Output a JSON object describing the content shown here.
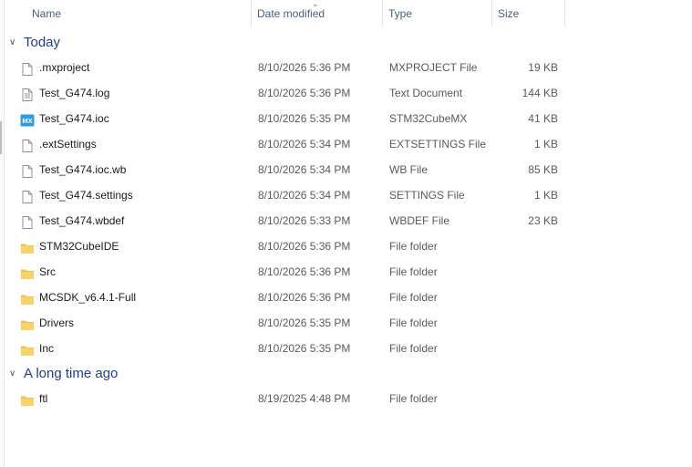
{
  "columns": {
    "name": "Name",
    "date": "Date modified",
    "type": "Type",
    "size": "Size"
  },
  "groups": [
    {
      "label": "Today"
    },
    {
      "label": "A long time ago"
    }
  ],
  "files": [
    {
      "name": ".mxproject",
      "date": "8/10/2026 5:36 PM",
      "type": "MXPROJECT File",
      "size": "19 KB",
      "icon": "file-icon"
    },
    {
      "name": "Test_G474.log",
      "date": "8/10/2026 5:36 PM",
      "type": "Text Document",
      "size": "144 KB",
      "icon": "text-file-icon"
    },
    {
      "name": "Test_G474.ioc",
      "date": "8/10/2026 5:35 PM",
      "type": "STM32CubeMX",
      "size": "41 KB",
      "icon": "stm32cubemx-icon",
      "icon_text": "MX"
    },
    {
      "name": ".extSettings",
      "date": "8/10/2026 5:34 PM",
      "type": "EXTSETTINGS File",
      "size": "1 KB",
      "icon": "file-icon"
    },
    {
      "name": "Test_G474.ioc.wb",
      "date": "8/10/2026 5:34 PM",
      "type": "WB File",
      "size": "85 KB",
      "icon": "file-icon"
    },
    {
      "name": "Test_G474.settings",
      "date": "8/10/2026 5:34 PM",
      "type": "SETTINGS File",
      "size": "1 KB",
      "icon": "file-icon"
    },
    {
      "name": "Test_G474.wbdef",
      "date": "8/10/2026 5:33 PM",
      "type": "WBDEF File",
      "size": "23 KB",
      "icon": "file-icon"
    },
    {
      "name": "STM32CubeIDE",
      "date": "8/10/2026 5:36 PM",
      "type": "File folder",
      "size": "",
      "icon": "folder-icon"
    },
    {
      "name": "Src",
      "date": "8/10/2026 5:36 PM",
      "type": "File folder",
      "size": "",
      "icon": "folder-icon"
    },
    {
      "name": "MCSDK_v6.4.1-Full",
      "date": "8/10/2026 5:36 PM",
      "type": "File folder",
      "size": "",
      "icon": "folder-icon"
    },
    {
      "name": "Drivers",
      "date": "8/10/2026 5:35 PM",
      "type": "File folder",
      "size": "",
      "icon": "folder-icon"
    },
    {
      "name": "Inc",
      "date": "8/10/2026 5:35 PM",
      "type": "File folder",
      "size": "",
      "icon": "folder-icon"
    },
    {
      "name": "ftl",
      "date": "8/19/2025 4:48 PM",
      "type": "File folder",
      "size": "",
      "icon": "folder-icon"
    }
  ],
  "colors": {
    "group_text": "#1e3f8a",
    "folder": "#f4c245",
    "mx_icon": "#2f9be0"
  }
}
